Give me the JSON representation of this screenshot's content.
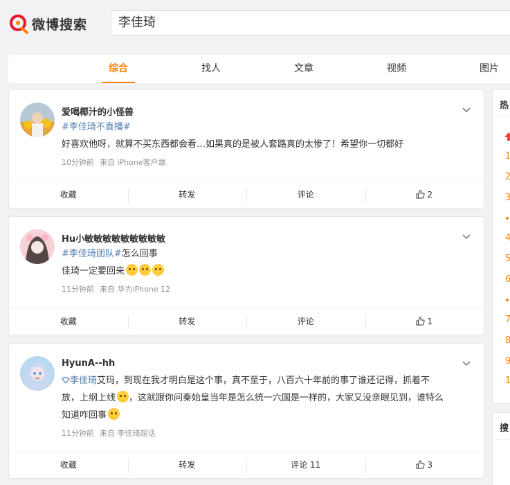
{
  "header": {
    "logo_text": "微博搜索",
    "search_value": "李佳琦"
  },
  "tabs": [
    "综合",
    "找人",
    "文章",
    "视频",
    "图片"
  ],
  "posts": [
    {
      "username": "爱喝椰汁的小怪兽",
      "line1_tag": "#李佳琦不直播#",
      "line2": "好喜欢他呀，就算不买东西都会看…如果真的是被人套路真的太惨了！希望你一切都好",
      "time": "10分钟前",
      "source": "来自 iPhone客户端",
      "actions": {
        "fav": "收藏",
        "repost": "转发",
        "comment": "评论",
        "like": "2"
      }
    },
    {
      "username": "Hu小敏敏敏敏敏敏敏敏敏",
      "line1_tag": "#李佳琦团队#",
      "line1_text": "怎么回事",
      "line2": "佳琦一定要回来",
      "time": "11分钟前",
      "source": "来自 华为iPhone 12",
      "actions": {
        "fav": "收藏",
        "repost": "转发",
        "comment": "评论",
        "like": "1"
      }
    },
    {
      "username": "HyunA--hh",
      "line1_tag": "李佳琦",
      "line1_text": "艾玛，到现在我才明白是这个事，真不至于，八百六十年前的事了谁还记得，抓着不",
      "line2_a": "放，上纲上线",
      "line2_b": "，这就跟你问秦始皇当年是怎么统一六国是一样的，大家又没亲眼见到，谁特么",
      "line3": "知道咋回事",
      "time": "11分钟前",
      "source": "来自 李佳琦超话",
      "actions": {
        "fav": "收藏",
        "repost": "转发",
        "comment": "评论 11",
        "like": "3"
      }
    }
  ],
  "sidebar": {
    "hot_title": "热",
    "ranks": [
      "1",
      "2",
      "3",
      "4",
      "5",
      "6",
      "7",
      "8",
      "9",
      "10"
    ],
    "search_title": "搜"
  }
}
